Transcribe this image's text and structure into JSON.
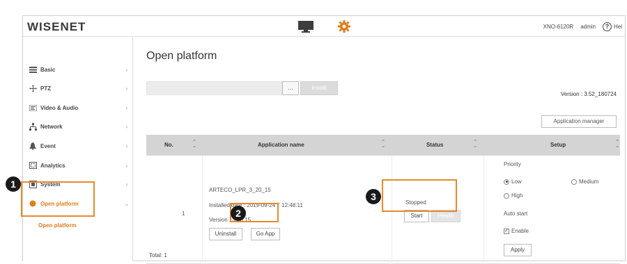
{
  "header": {
    "logo": "WISENET",
    "model": "XNO-6120R",
    "user": "admin",
    "help": "Hel"
  },
  "sidebar": {
    "items": [
      {
        "label": "Basic",
        "icon": "list-icon"
      },
      {
        "label": "PTZ",
        "icon": "move-icon"
      },
      {
        "label": "Video & Audio",
        "icon": "video-audio-icon"
      },
      {
        "label": "Network",
        "icon": "network-icon"
      },
      {
        "label": "Event",
        "icon": "event-icon"
      },
      {
        "label": "Analytics",
        "icon": "analytics-icon"
      },
      {
        "label": "System",
        "icon": "system-icon"
      },
      {
        "label": "Open platform",
        "icon": "open-platform-icon"
      }
    ],
    "sub_item": "Open platform",
    "arrow": "›",
    "arrow_open": "⌄"
  },
  "main": {
    "title": "Open platform",
    "browse_label": "...",
    "install_label": "Install",
    "version": "Version : 3.52_180724",
    "app_manager_label": "Application manager",
    "table": {
      "headers": [
        "No.",
        "Application name",
        "Status",
        "Setup"
      ],
      "row": {
        "no": "1",
        "app_name": "ARTECO_LPR_3_20_15",
        "installed_date": "Installed date : 2019-09-24 T 12:48:11",
        "version": "Version : 3.20.15",
        "uninstall_label": "Uninstall",
        "goapp_label": "Go App",
        "status": "Stopped",
        "start_label": "Start",
        "health_label": "Health",
        "setup": {
          "priority_label": "Priority",
          "low_label": "Low",
          "medium_label": "Medium",
          "high_label": "High",
          "autostart_label": "Auto start",
          "enable_label": "Enable",
          "apply_label": "Apply"
        }
      }
    },
    "total": "Total: 1"
  },
  "annotations": [
    "1",
    "2",
    "3"
  ],
  "colors": {
    "accent": "#e07c1a",
    "highlight": "#e8892b",
    "header_bg": "#d4d4d4"
  }
}
